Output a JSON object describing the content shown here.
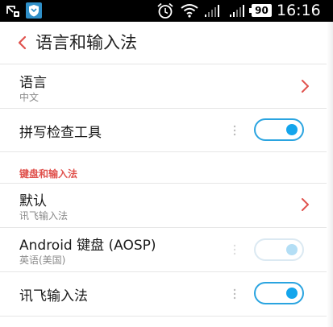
{
  "status_bar": {
    "battery": "90",
    "time": "16:16",
    "icons": [
      "missed-call-icon",
      "app-shield-icon",
      "alarm-icon",
      "wifi-icon",
      "signal-icon",
      "signal-icon",
      "battery-icon"
    ]
  },
  "header": {
    "title": "语言和输入法",
    "back_icon": "chevron-left-icon"
  },
  "rows": {
    "language": {
      "title": "语言",
      "subtitle": "中文"
    },
    "spellcheck": {
      "title": "拼写检查工具",
      "toggle_on": true
    }
  },
  "section": {
    "title": "键盘和输入法"
  },
  "keyboard_rows": {
    "default": {
      "title": "默认",
      "subtitle": "讯飞输入法"
    },
    "aosp": {
      "title": "Android 键盘 (AOSP)",
      "subtitle": "英语(美国)",
      "toggle_on": true,
      "disabled": true
    },
    "xunfei": {
      "title": "讯飞输入法",
      "toggle_on": true
    }
  },
  "colors": {
    "accent_red": "#e0524d",
    "toggle_blue": "#14a5ec",
    "status_bar_bg": "#000000"
  }
}
